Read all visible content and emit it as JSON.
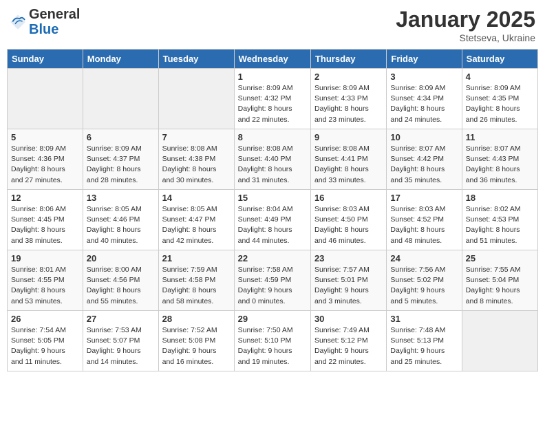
{
  "header": {
    "logo_general": "General",
    "logo_blue": "Blue",
    "month": "January 2025",
    "location": "Stetseva, Ukraine"
  },
  "weekdays": [
    "Sunday",
    "Monday",
    "Tuesday",
    "Wednesday",
    "Thursday",
    "Friday",
    "Saturday"
  ],
  "weeks": [
    [
      {
        "day": "",
        "info": ""
      },
      {
        "day": "",
        "info": ""
      },
      {
        "day": "",
        "info": ""
      },
      {
        "day": "1",
        "info": "Sunrise: 8:09 AM\nSunset: 4:32 PM\nDaylight: 8 hours\nand 22 minutes."
      },
      {
        "day": "2",
        "info": "Sunrise: 8:09 AM\nSunset: 4:33 PM\nDaylight: 8 hours\nand 23 minutes."
      },
      {
        "day": "3",
        "info": "Sunrise: 8:09 AM\nSunset: 4:34 PM\nDaylight: 8 hours\nand 24 minutes."
      },
      {
        "day": "4",
        "info": "Sunrise: 8:09 AM\nSunset: 4:35 PM\nDaylight: 8 hours\nand 26 minutes."
      }
    ],
    [
      {
        "day": "5",
        "info": "Sunrise: 8:09 AM\nSunset: 4:36 PM\nDaylight: 8 hours\nand 27 minutes."
      },
      {
        "day": "6",
        "info": "Sunrise: 8:09 AM\nSunset: 4:37 PM\nDaylight: 8 hours\nand 28 minutes."
      },
      {
        "day": "7",
        "info": "Sunrise: 8:08 AM\nSunset: 4:38 PM\nDaylight: 8 hours\nand 30 minutes."
      },
      {
        "day": "8",
        "info": "Sunrise: 8:08 AM\nSunset: 4:40 PM\nDaylight: 8 hours\nand 31 minutes."
      },
      {
        "day": "9",
        "info": "Sunrise: 8:08 AM\nSunset: 4:41 PM\nDaylight: 8 hours\nand 33 minutes."
      },
      {
        "day": "10",
        "info": "Sunrise: 8:07 AM\nSunset: 4:42 PM\nDaylight: 8 hours\nand 35 minutes."
      },
      {
        "day": "11",
        "info": "Sunrise: 8:07 AM\nSunset: 4:43 PM\nDaylight: 8 hours\nand 36 minutes."
      }
    ],
    [
      {
        "day": "12",
        "info": "Sunrise: 8:06 AM\nSunset: 4:45 PM\nDaylight: 8 hours\nand 38 minutes."
      },
      {
        "day": "13",
        "info": "Sunrise: 8:05 AM\nSunset: 4:46 PM\nDaylight: 8 hours\nand 40 minutes."
      },
      {
        "day": "14",
        "info": "Sunrise: 8:05 AM\nSunset: 4:47 PM\nDaylight: 8 hours\nand 42 minutes."
      },
      {
        "day": "15",
        "info": "Sunrise: 8:04 AM\nSunset: 4:49 PM\nDaylight: 8 hours\nand 44 minutes."
      },
      {
        "day": "16",
        "info": "Sunrise: 8:03 AM\nSunset: 4:50 PM\nDaylight: 8 hours\nand 46 minutes."
      },
      {
        "day": "17",
        "info": "Sunrise: 8:03 AM\nSunset: 4:52 PM\nDaylight: 8 hours\nand 48 minutes."
      },
      {
        "day": "18",
        "info": "Sunrise: 8:02 AM\nSunset: 4:53 PM\nDaylight: 8 hours\nand 51 minutes."
      }
    ],
    [
      {
        "day": "19",
        "info": "Sunrise: 8:01 AM\nSunset: 4:55 PM\nDaylight: 8 hours\nand 53 minutes."
      },
      {
        "day": "20",
        "info": "Sunrise: 8:00 AM\nSunset: 4:56 PM\nDaylight: 8 hours\nand 55 minutes."
      },
      {
        "day": "21",
        "info": "Sunrise: 7:59 AM\nSunset: 4:58 PM\nDaylight: 8 hours\nand 58 minutes."
      },
      {
        "day": "22",
        "info": "Sunrise: 7:58 AM\nSunset: 4:59 PM\nDaylight: 9 hours\nand 0 minutes."
      },
      {
        "day": "23",
        "info": "Sunrise: 7:57 AM\nSunset: 5:01 PM\nDaylight: 9 hours\nand 3 minutes."
      },
      {
        "day": "24",
        "info": "Sunrise: 7:56 AM\nSunset: 5:02 PM\nDaylight: 9 hours\nand 5 minutes."
      },
      {
        "day": "25",
        "info": "Sunrise: 7:55 AM\nSunset: 5:04 PM\nDaylight: 9 hours\nand 8 minutes."
      }
    ],
    [
      {
        "day": "26",
        "info": "Sunrise: 7:54 AM\nSunset: 5:05 PM\nDaylight: 9 hours\nand 11 minutes."
      },
      {
        "day": "27",
        "info": "Sunrise: 7:53 AM\nSunset: 5:07 PM\nDaylight: 9 hours\nand 14 minutes."
      },
      {
        "day": "28",
        "info": "Sunrise: 7:52 AM\nSunset: 5:08 PM\nDaylight: 9 hours\nand 16 minutes."
      },
      {
        "day": "29",
        "info": "Sunrise: 7:50 AM\nSunset: 5:10 PM\nDaylight: 9 hours\nand 19 minutes."
      },
      {
        "day": "30",
        "info": "Sunrise: 7:49 AM\nSunset: 5:12 PM\nDaylight: 9 hours\nand 22 minutes."
      },
      {
        "day": "31",
        "info": "Sunrise: 7:48 AM\nSunset: 5:13 PM\nDaylight: 9 hours\nand 25 minutes."
      },
      {
        "day": "",
        "info": ""
      }
    ]
  ]
}
